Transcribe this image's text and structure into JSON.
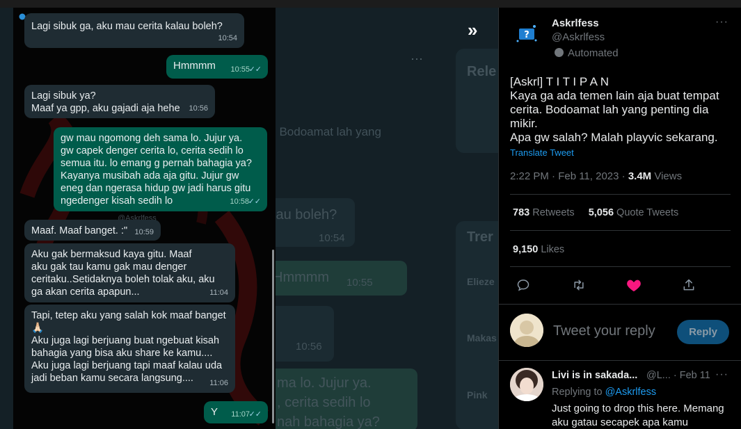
{
  "background": {
    "bg_text_1": "Rele",
    "bg_text_2": ", Bodoamat lah yang",
    "bg_text_3": "lau boleh?",
    "bg_text_4": "10:54",
    "bg_text_5": "Hmmmm",
    "bg_text_6": "10:55",
    "bg_text_7": "10:56",
    "bg_text_8": "Trer",
    "bg_text_9": "Elieze",
    "bg_text_10": "Makas",
    "bg_text_11": "Pink",
    "bg_text_12": "ma lo. Jujur ya.",
    "bg_text_13": ", cerita sedih lo",
    "bg_text_14": "nah bahagia ya?"
  },
  "chat": {
    "watermark": "@Askrlfess",
    "messages": [
      {
        "side": "in",
        "text": "Lagi sibuk ga, aku mau cerita kalau boleh?",
        "time": "10:54"
      },
      {
        "side": "out",
        "text": "Hmmmm",
        "time": "10:55"
      },
      {
        "side": "in",
        "text": "Lagi sibuk ya?\nMaaf ya gpp, aku gajadi aja hehe",
        "time": "10:56"
      },
      {
        "side": "out",
        "text": "gw mau ngomong deh sama lo. Jujur ya.\ngw capek denger cerita lo, cerita sedih lo\nsemua itu. lo emang g pernah bahagia ya?\nKayanya musibah ada aja gitu. Jujur gw\neneg dan ngerasa hidup gw jadi harus gitu\nngedenger kisah sedih lo",
        "time": "10:58"
      },
      {
        "side": "in",
        "text": "Maaf. Maaf banget. :\"",
        "time": "10:59"
      },
      {
        "side": "in",
        "text": "Aku gak bermaksud kaya gitu. Maaf\naku gak tau kamu gak mau denger\nceritaku..Setidaknya boleh tolak aku, aku\nga akan cerita apapun...",
        "time": "11:04"
      },
      {
        "side": "in",
        "text": "Tapi, tetep aku yang salah kok maaf banget\n🙏🏻\nAku juga lagi berjuang buat ngebuat kisah\nbahagia yang bisa aku share ke kamu....\nAku juga lagi berjuang tapi maaf kalau uda\njadi beban kamu secara langsung....",
        "time": "11:06"
      },
      {
        "side": "out",
        "text": "Y",
        "time": "11:07"
      }
    ]
  },
  "tweet": {
    "name": "Askrlfess",
    "handle": "@Askrlfess",
    "automated": "Automated",
    "body": "[Askrl] T I T I P A N\nKaya ga ada temen lain aja buat tempat cerita. Bodoamat lah yang penting dia mikir.\nApa gw salah? Malah playvic sekarang.",
    "translate": "Translate Tweet",
    "time": "2:22 PM · Feb 11, 2023 · ",
    "views_count": "3.4M",
    "views_label": " Views",
    "retweets_count": "783",
    "retweets_label": " Retweets",
    "quotes_count": "5,056",
    "quotes_label": " Quote Tweets",
    "likes_count": "9,150",
    "likes_label": " Likes",
    "reply_placeholder": "Tweet your reply",
    "reply_button": "Reply",
    "liked": true,
    "like_color": "#f91880"
  },
  "reply": {
    "name": "Livi is in sakada...",
    "handle_date": "@L... · Feb 11",
    "replying_prefix": "Replying to ",
    "replying_to": "@Askrlfess",
    "text": "Just going to drop this here. Memang\naku gatau secapek apa kamu"
  }
}
